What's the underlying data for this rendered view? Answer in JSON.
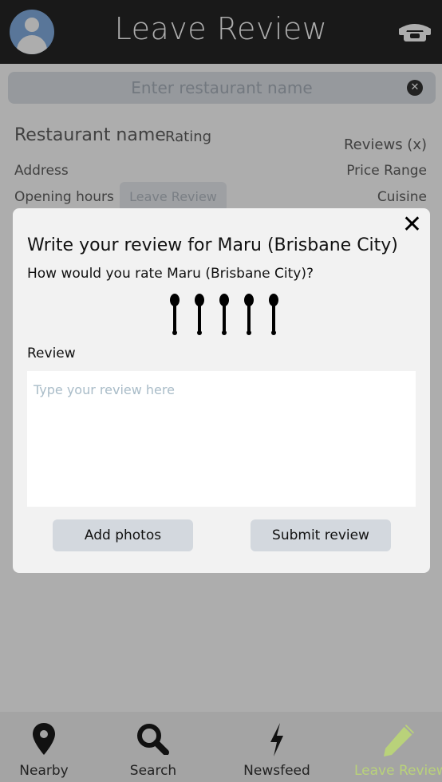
{
  "header": {
    "title": "Leave Review",
    "avatar_icon": "user-avatar-icon",
    "phone_icon": "phone-icon"
  },
  "search": {
    "placeholder": "Enter restaurant name",
    "clear_icon": "clear-circle-icon"
  },
  "restaurant_info": {
    "name_label": "Restaurant name",
    "rating_label": "Rating",
    "reviews_label": "Reviews (x)",
    "address_label": "Address",
    "price_label": "Price Range",
    "hours_label": "Opening hours",
    "leave_review_label": "Leave Review",
    "cuisine_label": "Cuisine"
  },
  "modal": {
    "title": "Write your review for Maru (Brisbane City)",
    "question": "How would you rate Maru (Brisbane City)?",
    "rating_icon": "spoon-icon",
    "rating_max": 5,
    "review_label": "Review",
    "review_placeholder": "Type your review here",
    "add_photos_label": "Add photos",
    "submit_label": "Submit review",
    "close_label": "✕"
  },
  "bottom_nav": {
    "items": [
      {
        "label": "Nearby",
        "icon": "map-pin-icon"
      },
      {
        "label": "Search",
        "icon": "search-icon"
      },
      {
        "label": "Newsfeed",
        "icon": "lightning-icon"
      },
      {
        "label": "Leave Review",
        "icon": "pencil-icon"
      }
    ],
    "active_label": "Leave Review",
    "active_color": "#b9d27a"
  },
  "colors": {
    "header_bg": "#000000",
    "overlay": "rgba(60,60,60,0.42)",
    "modal_bg": "#f2f2f2",
    "button_bg": "#d3d8de",
    "nav_bg": "#a4a4a4"
  }
}
